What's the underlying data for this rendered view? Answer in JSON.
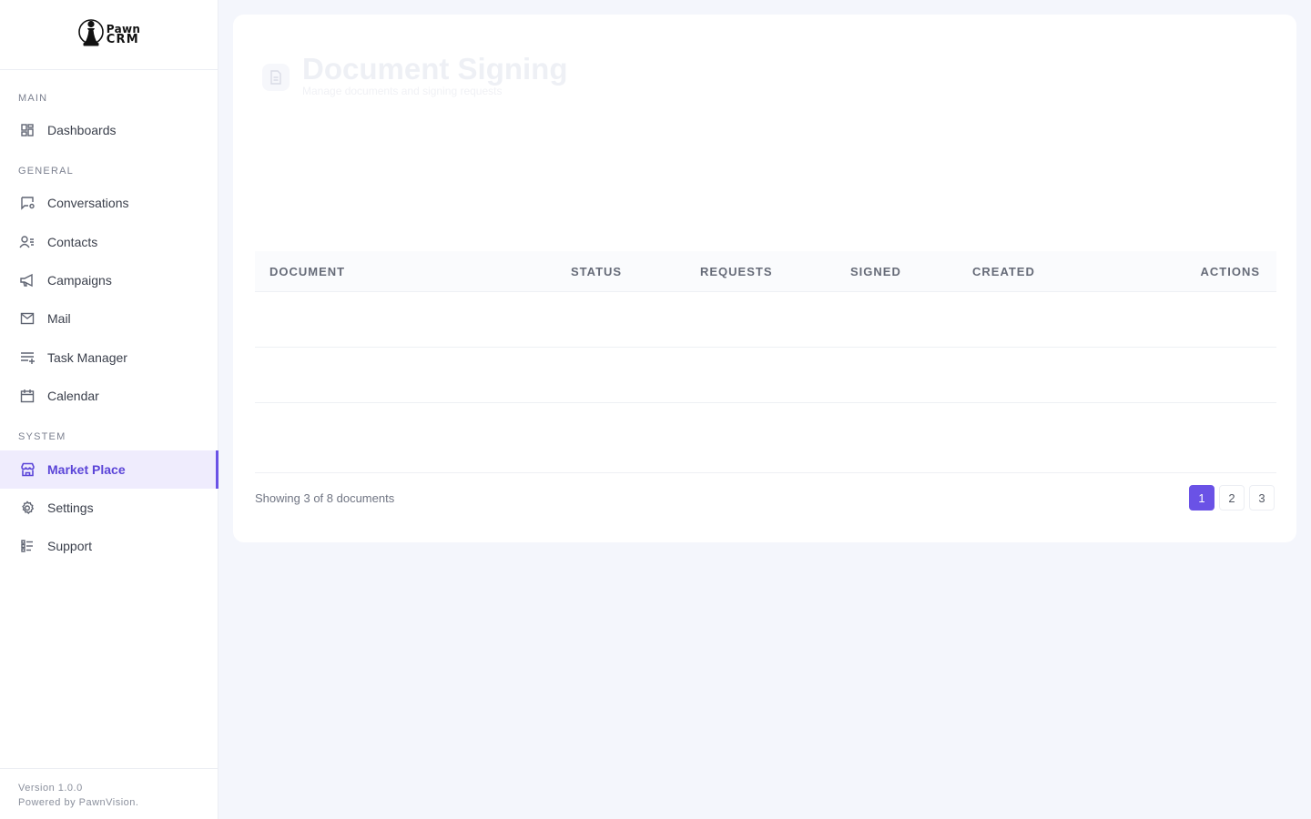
{
  "brand": {
    "line1": "Pawn",
    "line2": "CRM"
  },
  "sidebar": {
    "sections": {
      "main": "MAIN",
      "general": "GENERAL",
      "system": "SYSTEM"
    },
    "items": [
      {
        "label": "Dashboards",
        "icon": "dashboard-grid-icon"
      },
      {
        "label": "Conversations",
        "icon": "chat-settings-icon"
      },
      {
        "label": "Contacts",
        "icon": "contacts-list-icon"
      },
      {
        "label": "Campaigns",
        "icon": "megaphone-icon"
      },
      {
        "label": "Mail",
        "icon": "mail-envelope-icon"
      },
      {
        "label": "Task Manager",
        "icon": "task-list-add-icon"
      },
      {
        "label": "Calendar",
        "icon": "calendar-icon"
      },
      {
        "label": "Market Place",
        "icon": "storefront-icon",
        "active": true
      },
      {
        "label": "Settings",
        "icon": "gear-icon"
      },
      {
        "label": "Support",
        "icon": "support-list-icon"
      }
    ],
    "footer": {
      "version": "Version 1.0.0",
      "powered": "Powered by PawnVision."
    }
  },
  "page": {
    "title": "Document Signing",
    "subtitle": "Manage documents and signing requests"
  },
  "table": {
    "columns": [
      "DOCUMENT",
      "STATUS",
      "REQUESTS",
      "SIGNED",
      "CREATED",
      "ACTIONS"
    ],
    "rows": 3
  },
  "footer": {
    "showing": "Showing 3 of 8 documents",
    "pages": [
      "1",
      "2",
      "3"
    ],
    "current_page": "1"
  },
  "colors": {
    "accent": "#6a52e6",
    "active_bg": "#efecfd",
    "background": "#f4f6fc"
  }
}
